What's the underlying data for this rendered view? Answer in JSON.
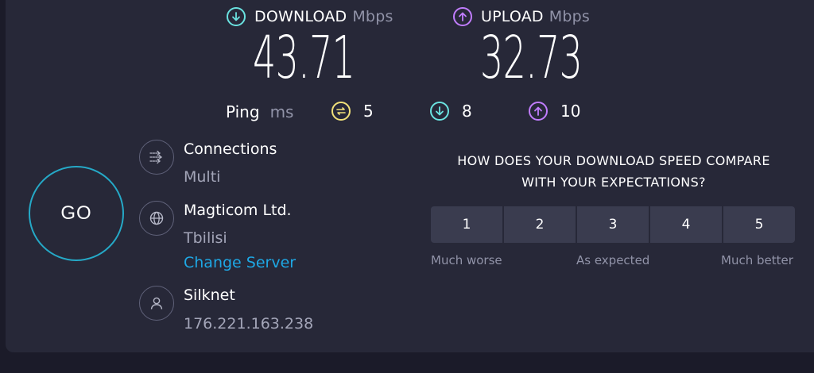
{
  "colors": {
    "background": "#1b1b29",
    "panel": "#272838",
    "download_accent": "#6ae2e0",
    "upload_accent": "#c17dff",
    "ping_accent": "#f3e27a",
    "go_ring": "#25a9c7",
    "link": "#1ea8e5"
  },
  "download": {
    "label": "DOWNLOAD",
    "unit": "Mbps",
    "value": "43.71",
    "icon": "arrow-down-circle-icon"
  },
  "upload": {
    "label": "UPLOAD",
    "unit": "Mbps",
    "value": "32.73",
    "icon": "arrow-up-circle-icon"
  },
  "ping": {
    "label": "Ping",
    "unit": "ms",
    "idle": {
      "value": "5",
      "icon": "ping-icon"
    },
    "download": {
      "value": "8",
      "icon": "arrow-down-circle-icon"
    },
    "upload": {
      "value": "10",
      "icon": "arrow-up-circle-icon"
    }
  },
  "go": {
    "label": "GO"
  },
  "connections": {
    "title": "Connections",
    "value": "Multi",
    "icon": "connections-icon"
  },
  "server": {
    "title": "Magticom Ltd.",
    "location": "Tbilisi",
    "change_label": "Change Server",
    "icon": "globe-icon"
  },
  "provider": {
    "title": "Silknet",
    "ip": "176.221.163.238",
    "icon": "user-icon"
  },
  "survey": {
    "question_line1": "HOW DOES YOUR DOWNLOAD SPEED COMPARE",
    "question_line2": "WITH YOUR EXPECTATIONS?",
    "options": [
      "1",
      "2",
      "3",
      "4",
      "5"
    ],
    "label_low": "Much worse",
    "label_mid": "As expected",
    "label_high": "Much better"
  }
}
